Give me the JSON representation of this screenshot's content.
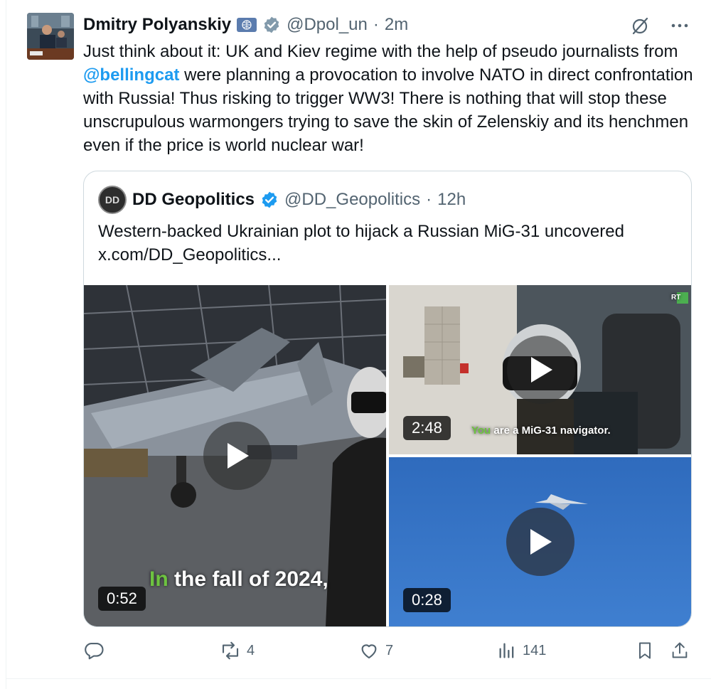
{
  "tweet": {
    "author_name": "Dmitry Polyanskiy",
    "handle": "@Dpol_un",
    "separator": "·",
    "time": "2m",
    "text_before": "Just think about it: UK and Kiev regime with the help of pseudo journalists from ",
    "mention": "@bellingcat",
    "text_after": " were planning a provocation to involve NATO in direct confrontation with Russia! Thus risking to trigger WW3! There is nothing that will stop these unscrupulous warmongers trying to save the skin of Zelenskiy and its henchmen even if the price is world nuclear war!"
  },
  "quote": {
    "author_name": "DD Geopolitics",
    "handle": "@DD_Geopolitics",
    "separator": "·",
    "time": "12h",
    "avatar_text": "DD",
    "text": "Western-backed Ukrainian plot to hijack a Russian MiG-31 uncovered",
    "link": "x.com/DD_Geopolitics..."
  },
  "media": [
    {
      "duration": "0:52",
      "caption_highlight": "In",
      "caption_rest": " the fall of 2024,"
    },
    {
      "duration": "2:48",
      "caption_highlight": "You",
      "caption_rest": " are a MiG-31 navigator.",
      "watermark": "RT"
    },
    {
      "duration": "0:28"
    }
  ],
  "actions": {
    "reply_count": "",
    "repost_count": "4",
    "like_count": "7",
    "views_count": "141"
  },
  "icons": {
    "verified": "verified-check-icon",
    "gov": "un-affiliation-badge-icon",
    "grok": "grok-icon",
    "more": "more-icon",
    "reply": "reply-icon",
    "repost": "repost-icon",
    "like": "like-icon",
    "views": "views-icon",
    "bookmark": "bookmark-icon",
    "share": "share-icon"
  },
  "colors": {
    "accent": "#1d9bf0",
    "secondary_text": "#536471",
    "caption_highlight": "#6dc340"
  }
}
